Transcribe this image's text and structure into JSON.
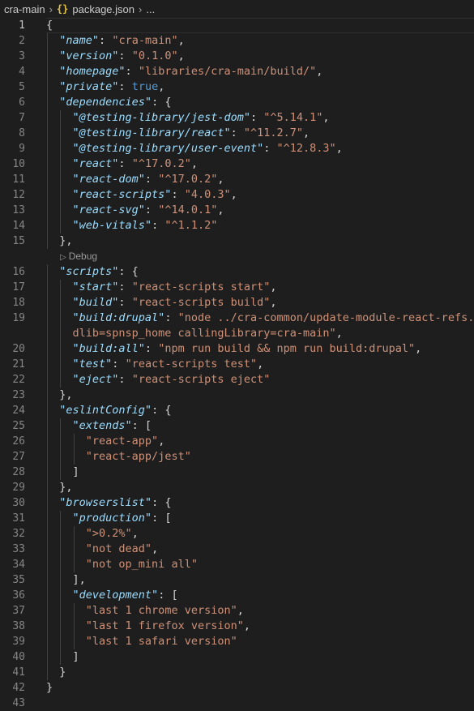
{
  "breadcrumb": {
    "folder": "cra-main",
    "file_icon": "{}",
    "file": "package.json",
    "ellipsis": "..."
  },
  "codelens": {
    "label": "Debug"
  },
  "lines": [
    {
      "n": "1",
      "tokens": [
        {
          "t": "p",
          "v": "{"
        }
      ],
      "current": true
    },
    {
      "n": "2",
      "tokens": [
        {
          "t": "pad",
          "v": "  "
        },
        {
          "t": "key",
          "v": "\"name\""
        },
        {
          "t": "p",
          "v": ": "
        },
        {
          "t": "str",
          "v": "\"cra-main\""
        },
        {
          "t": "p",
          "v": ","
        }
      ]
    },
    {
      "n": "3",
      "tokens": [
        {
          "t": "pad",
          "v": "  "
        },
        {
          "t": "key",
          "v": "\"version\""
        },
        {
          "t": "p",
          "v": ": "
        },
        {
          "t": "str",
          "v": "\"0.1.0\""
        },
        {
          "t": "p",
          "v": ","
        }
      ]
    },
    {
      "n": "4",
      "tokens": [
        {
          "t": "pad",
          "v": "  "
        },
        {
          "t": "key",
          "v": "\"homepage\""
        },
        {
          "t": "p",
          "v": ": "
        },
        {
          "t": "str",
          "v": "\"libraries/cra-main/build/\""
        },
        {
          "t": "p",
          "v": ","
        }
      ]
    },
    {
      "n": "5",
      "tokens": [
        {
          "t": "pad",
          "v": "  "
        },
        {
          "t": "key",
          "v": "\"private\""
        },
        {
          "t": "p",
          "v": ": "
        },
        {
          "t": "kw",
          "v": "true"
        },
        {
          "t": "p",
          "v": ","
        }
      ]
    },
    {
      "n": "6",
      "tokens": [
        {
          "t": "pad",
          "v": "  "
        },
        {
          "t": "key",
          "v": "\"dependencies\""
        },
        {
          "t": "p",
          "v": ": {"
        }
      ]
    },
    {
      "n": "7",
      "tokens": [
        {
          "t": "pad",
          "v": "    "
        },
        {
          "t": "key",
          "v": "\"@testing-library/jest-dom\""
        },
        {
          "t": "p",
          "v": ": "
        },
        {
          "t": "str",
          "v": "\"^5.14.1\""
        },
        {
          "t": "p",
          "v": ","
        }
      ]
    },
    {
      "n": "8",
      "tokens": [
        {
          "t": "pad",
          "v": "    "
        },
        {
          "t": "key",
          "v": "\"@testing-library/react\""
        },
        {
          "t": "p",
          "v": ": "
        },
        {
          "t": "str",
          "v": "\"^11.2.7\""
        },
        {
          "t": "p",
          "v": ","
        }
      ]
    },
    {
      "n": "9",
      "tokens": [
        {
          "t": "pad",
          "v": "    "
        },
        {
          "t": "key",
          "v": "\"@testing-library/user-event\""
        },
        {
          "t": "p",
          "v": ": "
        },
        {
          "t": "str",
          "v": "\"^12.8.3\""
        },
        {
          "t": "p",
          "v": ","
        }
      ]
    },
    {
      "n": "10",
      "tokens": [
        {
          "t": "pad",
          "v": "    "
        },
        {
          "t": "key",
          "v": "\"react\""
        },
        {
          "t": "p",
          "v": ": "
        },
        {
          "t": "str",
          "v": "\"^17.0.2\""
        },
        {
          "t": "p",
          "v": ","
        }
      ]
    },
    {
      "n": "11",
      "tokens": [
        {
          "t": "pad",
          "v": "    "
        },
        {
          "t": "key",
          "v": "\"react-dom\""
        },
        {
          "t": "p",
          "v": ": "
        },
        {
          "t": "str",
          "v": "\"^17.0.2\""
        },
        {
          "t": "p",
          "v": ","
        }
      ]
    },
    {
      "n": "12",
      "tokens": [
        {
          "t": "pad",
          "v": "    "
        },
        {
          "t": "key",
          "v": "\"react-scripts\""
        },
        {
          "t": "p",
          "v": ": "
        },
        {
          "t": "str",
          "v": "\"4.0.3\""
        },
        {
          "t": "p",
          "v": ","
        }
      ]
    },
    {
      "n": "13",
      "tokens": [
        {
          "t": "pad",
          "v": "    "
        },
        {
          "t": "key",
          "v": "\"react-svg\""
        },
        {
          "t": "p",
          "v": ": "
        },
        {
          "t": "str",
          "v": "\"^14.0.1\""
        },
        {
          "t": "p",
          "v": ","
        }
      ]
    },
    {
      "n": "14",
      "tokens": [
        {
          "t": "pad",
          "v": "    "
        },
        {
          "t": "key",
          "v": "\"web-vitals\""
        },
        {
          "t": "p",
          "v": ": "
        },
        {
          "t": "str",
          "v": "\"^1.1.2\""
        }
      ]
    },
    {
      "n": "15",
      "tokens": [
        {
          "t": "pad",
          "v": "  "
        },
        {
          "t": "p",
          "v": "},"
        }
      ]
    },
    {
      "lens": true
    },
    {
      "n": "16",
      "tokens": [
        {
          "t": "pad",
          "v": "  "
        },
        {
          "t": "key",
          "v": "\"scripts\""
        },
        {
          "t": "p",
          "v": ": {"
        }
      ]
    },
    {
      "n": "17",
      "tokens": [
        {
          "t": "pad",
          "v": "    "
        },
        {
          "t": "key",
          "v": "\"start\""
        },
        {
          "t": "p",
          "v": ": "
        },
        {
          "t": "str",
          "v": "\"react-scripts start\""
        },
        {
          "t": "p",
          "v": ","
        }
      ]
    },
    {
      "n": "18",
      "tokens": [
        {
          "t": "pad",
          "v": "    "
        },
        {
          "t": "key",
          "v": "\"build\""
        },
        {
          "t": "p",
          "v": ": "
        },
        {
          "t": "str",
          "v": "\"react-scripts build\""
        },
        {
          "t": "p",
          "v": ","
        }
      ]
    },
    {
      "n": "19",
      "tokens": [
        {
          "t": "pad",
          "v": "    "
        },
        {
          "t": "key",
          "v": "\"build:drupal\""
        },
        {
          "t": "p",
          "v": ": "
        },
        {
          "t": "str",
          "v": "\"node ../cra-common/update-module-react-refs.js"
        }
      ]
    },
    {
      "n": "",
      "tokens": [
        {
          "t": "pad",
          "v": "    "
        },
        {
          "t": "str",
          "v": "dlib=spnsp_home callingLibrary=cra-main\""
        },
        {
          "t": "p",
          "v": ","
        }
      ]
    },
    {
      "n": "20",
      "tokens": [
        {
          "t": "pad",
          "v": "    "
        },
        {
          "t": "key",
          "v": "\"build:all\""
        },
        {
          "t": "p",
          "v": ": "
        },
        {
          "t": "str",
          "v": "\"npm run build && npm run build:drupal\""
        },
        {
          "t": "p",
          "v": ","
        }
      ]
    },
    {
      "n": "21",
      "tokens": [
        {
          "t": "pad",
          "v": "    "
        },
        {
          "t": "key",
          "v": "\"test\""
        },
        {
          "t": "p",
          "v": ": "
        },
        {
          "t": "str",
          "v": "\"react-scripts test\""
        },
        {
          "t": "p",
          "v": ","
        }
      ]
    },
    {
      "n": "22",
      "tokens": [
        {
          "t": "pad",
          "v": "    "
        },
        {
          "t": "key",
          "v": "\"eject\""
        },
        {
          "t": "p",
          "v": ": "
        },
        {
          "t": "str",
          "v": "\"react-scripts eject\""
        }
      ]
    },
    {
      "n": "23",
      "tokens": [
        {
          "t": "pad",
          "v": "  "
        },
        {
          "t": "p",
          "v": "},"
        }
      ]
    },
    {
      "n": "24",
      "tokens": [
        {
          "t": "pad",
          "v": "  "
        },
        {
          "t": "key",
          "v": "\"eslintConfig\""
        },
        {
          "t": "p",
          "v": ": {"
        }
      ]
    },
    {
      "n": "25",
      "tokens": [
        {
          "t": "pad",
          "v": "    "
        },
        {
          "t": "key",
          "v": "\"extends\""
        },
        {
          "t": "p",
          "v": ": ["
        }
      ]
    },
    {
      "n": "26",
      "tokens": [
        {
          "t": "pad",
          "v": "      "
        },
        {
          "t": "str",
          "v": "\"react-app\""
        },
        {
          "t": "p",
          "v": ","
        }
      ]
    },
    {
      "n": "27",
      "tokens": [
        {
          "t": "pad",
          "v": "      "
        },
        {
          "t": "str",
          "v": "\"react-app/jest\""
        }
      ]
    },
    {
      "n": "28",
      "tokens": [
        {
          "t": "pad",
          "v": "    "
        },
        {
          "t": "p",
          "v": "]"
        }
      ]
    },
    {
      "n": "29",
      "tokens": [
        {
          "t": "pad",
          "v": "  "
        },
        {
          "t": "p",
          "v": "},"
        }
      ]
    },
    {
      "n": "30",
      "tokens": [
        {
          "t": "pad",
          "v": "  "
        },
        {
          "t": "key",
          "v": "\"browserslist\""
        },
        {
          "t": "p",
          "v": ": {"
        }
      ]
    },
    {
      "n": "31",
      "tokens": [
        {
          "t": "pad",
          "v": "    "
        },
        {
          "t": "key",
          "v": "\"production\""
        },
        {
          "t": "p",
          "v": ": ["
        }
      ]
    },
    {
      "n": "32",
      "tokens": [
        {
          "t": "pad",
          "v": "      "
        },
        {
          "t": "str",
          "v": "\">0.2%\""
        },
        {
          "t": "p",
          "v": ","
        }
      ]
    },
    {
      "n": "33",
      "tokens": [
        {
          "t": "pad",
          "v": "      "
        },
        {
          "t": "str",
          "v": "\"not dead\""
        },
        {
          "t": "p",
          "v": ","
        }
      ]
    },
    {
      "n": "34",
      "tokens": [
        {
          "t": "pad",
          "v": "      "
        },
        {
          "t": "str",
          "v": "\"not op_mini all\""
        }
      ]
    },
    {
      "n": "35",
      "tokens": [
        {
          "t": "pad",
          "v": "    "
        },
        {
          "t": "p",
          "v": "],"
        }
      ]
    },
    {
      "n": "36",
      "tokens": [
        {
          "t": "pad",
          "v": "    "
        },
        {
          "t": "key",
          "v": "\"development\""
        },
        {
          "t": "p",
          "v": ": ["
        }
      ]
    },
    {
      "n": "37",
      "tokens": [
        {
          "t": "pad",
          "v": "      "
        },
        {
          "t": "str",
          "v": "\"last 1 chrome version\""
        },
        {
          "t": "p",
          "v": ","
        }
      ]
    },
    {
      "n": "38",
      "tokens": [
        {
          "t": "pad",
          "v": "      "
        },
        {
          "t": "str",
          "v": "\"last 1 firefox version\""
        },
        {
          "t": "p",
          "v": ","
        }
      ]
    },
    {
      "n": "39",
      "tokens": [
        {
          "t": "pad",
          "v": "      "
        },
        {
          "t": "str",
          "v": "\"last 1 safari version\""
        }
      ]
    },
    {
      "n": "40",
      "tokens": [
        {
          "t": "pad",
          "v": "    "
        },
        {
          "t": "p",
          "v": "]"
        }
      ]
    },
    {
      "n": "41",
      "tokens": [
        {
          "t": "pad",
          "v": "  "
        },
        {
          "t": "p",
          "v": "}"
        }
      ]
    },
    {
      "n": "42",
      "tokens": [
        {
          "t": "p",
          "v": "}"
        }
      ]
    },
    {
      "n": "43",
      "tokens": []
    }
  ]
}
